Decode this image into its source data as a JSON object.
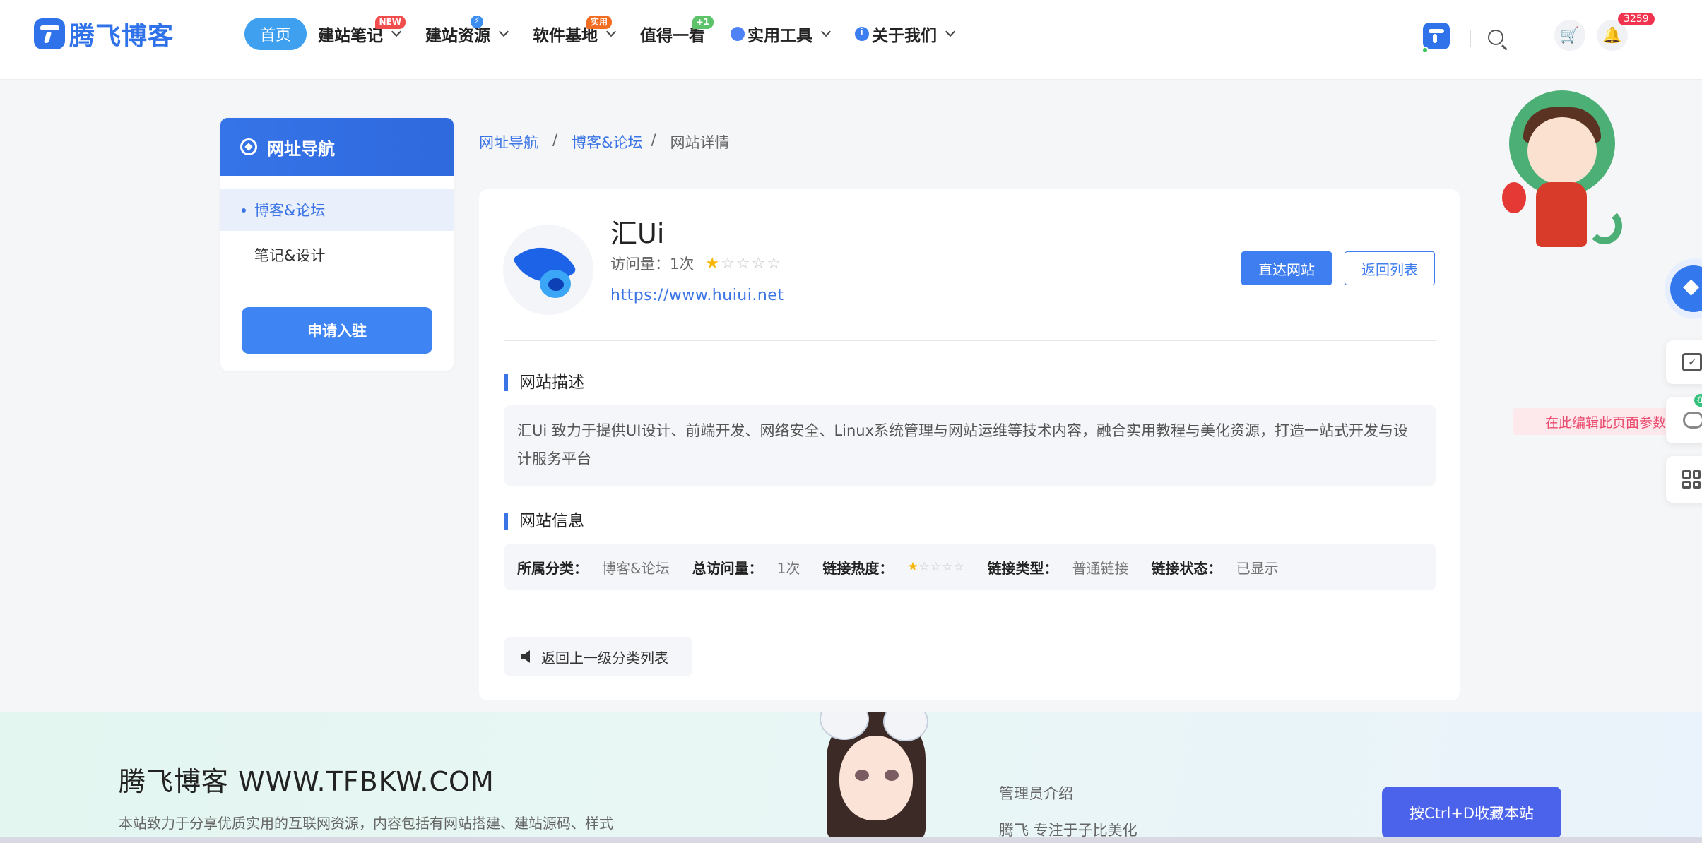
{
  "header": {
    "brand": "腾飞博客",
    "nav": {
      "home": "首页",
      "items": [
        {
          "label": "建站笔记",
          "badge": "NEW"
        },
        {
          "label": "建站资源",
          "badge": "⚡"
        },
        {
          "label": "软件基地",
          "badge": "实用"
        },
        {
          "label": "值得一看",
          "badge": "+1"
        },
        {
          "label": "实用工具"
        },
        {
          "label": "关于我们"
        }
      ]
    },
    "notification_count": "3259",
    "icons": {
      "search": "search-icon",
      "cart": "cart-icon",
      "bell": "bell-icon"
    }
  },
  "sidebar": {
    "title": "网址导航",
    "items": [
      {
        "label": "博客&论坛",
        "active": true
      },
      {
        "label": "笔记&设计",
        "active": false
      }
    ],
    "apply_label": "申请入驻"
  },
  "breadcrumb": {
    "level1": "网址导航",
    "level2": "博客&论坛",
    "current": "网站详情",
    "sep": "/"
  },
  "site": {
    "name": "汇Ui",
    "visits_label": "访问量：1次",
    "rating_stars": 1,
    "rating_max": 5,
    "url": "https://www.huiui.net",
    "visit_btn": "直达网站",
    "back_btn": "返回列表"
  },
  "description": {
    "title": "网站描述",
    "text": "汇Ui 致力于提供UI设计、前端开发、网络安全、Linux系统管理与网站运维等技术内容，融合实用教程与美化资源，打造一站式开发与设计服务平台"
  },
  "info": {
    "title": "网站信息",
    "category_k": "所属分类：",
    "category_v": "博客&论坛",
    "visits_k": "总访问量：",
    "visits_v": "1次",
    "heat_k": "链接热度：",
    "heat_stars": 1,
    "type_k": "链接类型：",
    "type_v": "普通链接",
    "status_k": "链接状态：",
    "status_v": "已显示"
  },
  "back_up_label": "返回上一级分类列表",
  "floating": {
    "edit_hint": "在此编辑此页面参数",
    "green_tag": "在"
  },
  "footer": {
    "title": "腾飞博客 WWW.TFBKW.COM",
    "desc": "本站致力于分享优质实用的互联网资源，内容包括有网站搭建、建站源码、样式",
    "admin_title": "管理员介绍",
    "admin_text": "腾飞 专注于子比美化",
    "fav_label": "按Ctrl+D收藏本站"
  },
  "colors": {
    "brand": "#2f72e9",
    "accent": "#3e7ef0",
    "star": "#f6b600",
    "alert": "#f0334f"
  }
}
